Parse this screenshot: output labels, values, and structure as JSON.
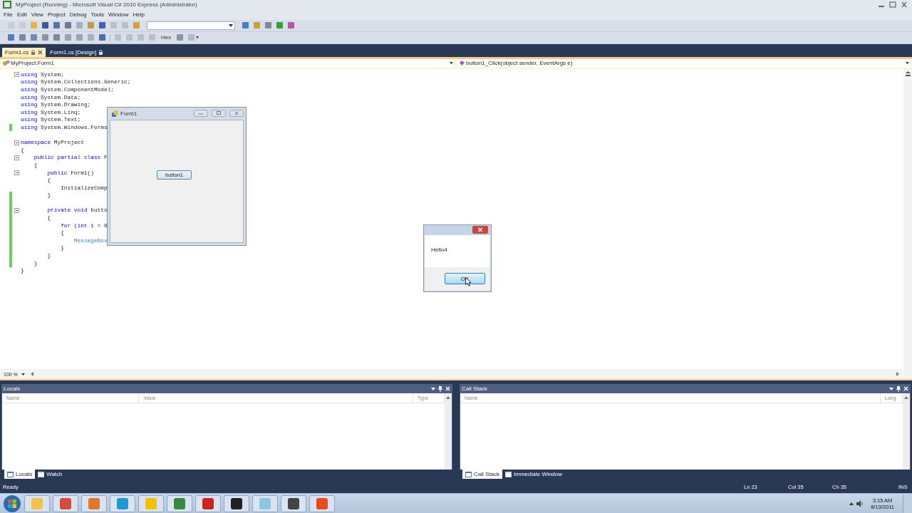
{
  "window": {
    "title": "MyProject (Running) - Microsoft Visual C# 2010 Express (Administrator)"
  },
  "menu": [
    "File",
    "Edit",
    "View",
    "Project",
    "Debug",
    "Tools",
    "Window",
    "Help"
  ],
  "toolbar": {
    "hex_label": "Hex"
  },
  "document_tabs": [
    {
      "label": "Form1.cs",
      "selected": true
    },
    {
      "label": "Form1.cs [Design]",
      "selected": false
    }
  ],
  "navigation_bar": {
    "type_dropdown": "MyProject.Form1",
    "member_dropdown": "button1_Click(object sender, EventArgs e)"
  },
  "code_lines": [
    {
      "fold": true,
      "changed": false,
      "tokens": [
        {
          "text": "using",
          "kind": "keyword"
        },
        {
          "text": " System;",
          "kind": "plain"
        }
      ]
    },
    {
      "fold": false,
      "changed": false,
      "tokens": [
        {
          "text": "using",
          "kind": "keyword"
        },
        {
          "text": " System.Collections.Generic;",
          "kind": "plain"
        }
      ]
    },
    {
      "fold": false,
      "changed": false,
      "tokens": [
        {
          "text": "using",
          "kind": "keyword"
        },
        {
          "text": " System.ComponentModel;",
          "kind": "plain"
        }
      ]
    },
    {
      "fold": false,
      "changed": false,
      "tokens": [
        {
          "text": "using",
          "kind": "keyword"
        },
        {
          "text": " System.Data;",
          "kind": "plain"
        }
      ]
    },
    {
      "fold": false,
      "changed": false,
      "tokens": [
        {
          "text": "using",
          "kind": "keyword"
        },
        {
          "text": " System.Drawing;",
          "kind": "plain"
        }
      ]
    },
    {
      "fold": false,
      "changed": false,
      "tokens": [
        {
          "text": "using",
          "kind": "keyword"
        },
        {
          "text": " System.Linq;",
          "kind": "plain"
        }
      ]
    },
    {
      "fold": false,
      "changed": false,
      "tokens": [
        {
          "text": "using",
          "kind": "keyword"
        },
        {
          "text": " System.Text;",
          "kind": "plain"
        }
      ]
    },
    {
      "fold": false,
      "changed": true,
      "tokens": [
        {
          "text": "using",
          "kind": "keyword"
        },
        {
          "text": " System.Windows.Forms",
          "kind": "plain"
        }
      ]
    },
    {
      "fold": false,
      "changed": false
    },
    {
      "fold": true,
      "changed": false,
      "tokens": [
        {
          "text": "namespace",
          "kind": "keyword"
        },
        {
          "text": " MyProject",
          "kind": "plain"
        }
      ]
    },
    {
      "fold": false,
      "changed": false,
      "tokens": [
        {
          "text": "{",
          "kind": "plain"
        }
      ]
    },
    {
      "fold": true,
      "changed": false,
      "tokens": [
        {
          "text": "    public partial class",
          "kind": "keyword"
        },
        {
          "text": " F",
          "kind": "plain"
        }
      ]
    },
    {
      "fold": false,
      "changed": false,
      "tokens": [
        {
          "text": "    {",
          "kind": "plain"
        }
      ]
    },
    {
      "fold": true,
      "changed": false,
      "tokens": [
        {
          "text": "        public",
          "kind": "keyword"
        },
        {
          "text": " Form1()",
          "kind": "plain"
        }
      ]
    },
    {
      "fold": false,
      "changed": false,
      "tokens": [
        {
          "text": "        {",
          "kind": "plain"
        }
      ]
    },
    {
      "fold": false,
      "changed": false,
      "tokens": [
        {
          "text": "            InitializeComp",
          "kind": "plain"
        }
      ]
    },
    {
      "fold": false,
      "changed": true,
      "tokens": [
        {
          "text": "        }",
          "kind": "plain"
        }
      ]
    },
    {
      "fold": false,
      "changed": true
    },
    {
      "fold": true,
      "changed": true,
      "tokens": [
        {
          "text": "        private void",
          "kind": "keyword"
        },
        {
          "text": " butto",
          "kind": "plain"
        }
      ]
    },
    {
      "fold": false,
      "changed": true,
      "tokens": [
        {
          "text": "        {",
          "kind": "plain"
        }
      ]
    },
    {
      "fold": false,
      "changed": true,
      "tokens": [
        {
          "text": "            for",
          "kind": "keyword"
        },
        {
          "text": " (",
          "kind": "plain"
        },
        {
          "text": "int",
          "kind": "keyword"
        },
        {
          "text": " i = 0",
          "kind": "plain"
        }
      ]
    },
    {
      "fold": false,
      "changed": true,
      "tokens": [
        {
          "text": "            {",
          "kind": "plain"
        }
      ]
    },
    {
      "fold": false,
      "changed": true,
      "tokens": [
        {
          "text": "                MessageBox",
          "kind": "type"
        }
      ]
    },
    {
      "fold": false,
      "changed": true,
      "tokens": [
        {
          "text": "            }",
          "kind": "plain"
        }
      ]
    },
    {
      "fold": false,
      "changed": true,
      "tokens": [
        {
          "text": "        }",
          "kind": "plain"
        }
      ]
    },
    {
      "fold": false,
      "changed": true,
      "tokens": [
        {
          "text": "    }",
          "kind": "plain"
        }
      ]
    },
    {
      "fold": false,
      "changed": false,
      "tokens": [
        {
          "text": "}",
          "kind": "plain"
        }
      ]
    }
  ],
  "zoom": "100 %",
  "running_form": {
    "title": "Form1",
    "button": "button1"
  },
  "message_box": {
    "message": "Hello4",
    "button": "OK"
  },
  "tool_windows": [
    {
      "title": "Locals",
      "columns": [
        "Name",
        "Value",
        "Type"
      ],
      "tabs": [
        {
          "label": "Locals",
          "selected": true
        },
        {
          "label": "Watch",
          "selected": false
        }
      ]
    },
    {
      "title": "Call Stack",
      "columns": [
        "Name",
        "Lang"
      ],
      "tabs": [
        {
          "label": "Call Stack",
          "selected": true
        },
        {
          "label": "Immediate Window",
          "selected": false
        }
      ]
    }
  ],
  "status_bar": {
    "message": "Ready",
    "line": "Ln 23",
    "column": "Col 35",
    "char": "Ch 35",
    "mode": "INS"
  },
  "taskbar": {
    "time": "3:15 AM",
    "date": "8/13/2011"
  }
}
